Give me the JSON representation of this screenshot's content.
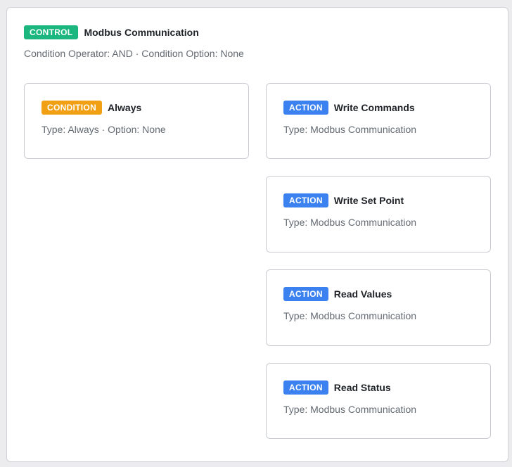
{
  "colors": {
    "control_badge": "#1cb67f",
    "condition_badge": "#f2a013",
    "action_badge": "#3b82f0"
  },
  "control": {
    "badge": "CONTROL",
    "title": "Modbus Communication",
    "subtitle": "Condition Operator: AND · Condition Option: None"
  },
  "condition": {
    "badge": "CONDITION",
    "title": "Always",
    "subtitle": "Type: Always · Option: None"
  },
  "actions": [
    {
      "badge": "ACTION",
      "title": "Write Commands",
      "subtitle": "Type: Modbus Communication"
    },
    {
      "badge": "ACTION",
      "title": "Write Set Point",
      "subtitle": "Type: Modbus Communication"
    },
    {
      "badge": "ACTION",
      "title": "Read Values",
      "subtitle": "Type: Modbus Communication"
    },
    {
      "badge": "ACTION",
      "title": "Read Status",
      "subtitle": "Type: Modbus Communication"
    }
  ]
}
